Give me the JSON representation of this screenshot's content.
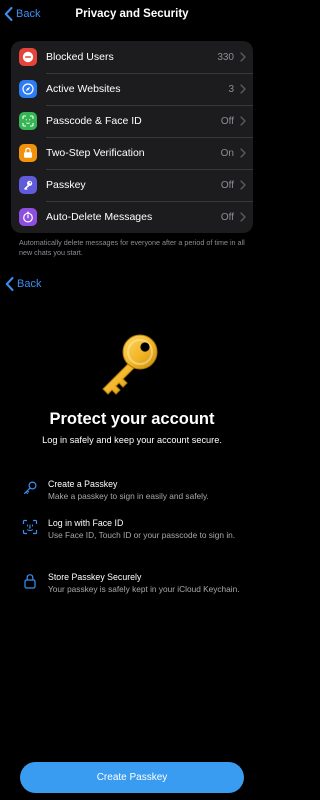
{
  "nav": {
    "back_label": "Back",
    "title": "Privacy and Security"
  },
  "settings": [
    {
      "label": "Blocked Users",
      "value": "330",
      "icon": "minus-circle-icon",
      "color": "#e5443a"
    },
    {
      "label": "Active Websites",
      "value": "3",
      "icon": "compass-icon",
      "color": "#2c7cf6"
    },
    {
      "label": "Passcode & Face ID",
      "value": "Off",
      "icon": "face-id-icon",
      "color": "#35b553"
    },
    {
      "label": "Two-Step Verification",
      "value": "On",
      "icon": "key-icon",
      "color": "#f2920a"
    },
    {
      "label": "Passkey",
      "value": "Off",
      "icon": "passkey-icon",
      "color": "#5f5bdb"
    },
    {
      "label": "Auto-Delete Messages",
      "value": "Off",
      "icon": "timer-icon",
      "color": "#8e4fe0"
    }
  ],
  "footnote": "Automatically delete messages for everyone after a period of time in all new chats you start.",
  "passkey_screen": {
    "back_label": "Back",
    "headline": "Protect your account",
    "subline": "Log in safely and keep your account secure.",
    "features": [
      {
        "title": "Create a Passkey",
        "desc": "Make a passkey to sign in easily and safely.",
        "icon": "key-outline-icon"
      },
      {
        "title": "Log in with Face ID",
        "desc": "Use Face ID, Touch ID or your passcode to sign in.",
        "icon": "face-scan-icon"
      },
      {
        "title": "Store Passkey Securely",
        "desc": "Your passkey is safely kept in your iCloud Keychain.",
        "icon": "lock-icon"
      }
    ],
    "cta_label": "Create Passkey"
  },
  "colors": {
    "accent": "#3b8ff4",
    "button": "#3a9cf0",
    "list_bg": "#1c1c1e",
    "key_gold": "#f3b627"
  }
}
